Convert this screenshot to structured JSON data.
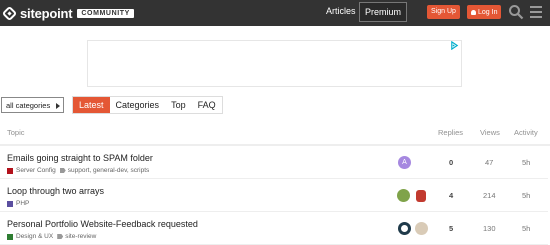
{
  "header": {
    "logo_text": "sitepoint",
    "logo_badge": "COMMUNITY",
    "nav_articles": "Articles",
    "nav_premium": "Premium",
    "signup_label": "Sign Up",
    "login_label": "Log In",
    "bg_color": "#333333",
    "accent_color": "#e45735"
  },
  "filters": {
    "category_dropdown": "all categories",
    "tabs": [
      {
        "label": "Latest",
        "active": true
      },
      {
        "label": "Categories",
        "active": false
      },
      {
        "label": "Top",
        "active": false
      },
      {
        "label": "FAQ",
        "active": false
      }
    ]
  },
  "table": {
    "columns": {
      "topic": "Topic",
      "replies": "Replies",
      "views": "Views",
      "activity": "Activity"
    },
    "rows": [
      {
        "title": "Emails going straight to SPAM folder",
        "category": "Server Config",
        "category_color": "#b3121c",
        "tags": "support, general-dev, scripts",
        "avatars": [
          {
            "letter": "A",
            "color": "#a688e0"
          }
        ],
        "replies": "0",
        "views": "47",
        "activity": "5h"
      },
      {
        "title": "Loop through two arrays",
        "category": "PHP",
        "category_color": "#5b4fa0",
        "tags": "",
        "avatars": [
          {
            "letter": "",
            "color": "#7fa34a"
          },
          {
            "letter": "",
            "color": "#c23a2f"
          }
        ],
        "replies": "4",
        "views": "214",
        "activity": "5h"
      },
      {
        "title": "Personal Portfolio Website-Feedback requested",
        "category": "Design & UX",
        "category_color": "#2e7d32",
        "tags": "site-review",
        "avatars": [
          {
            "letter": "",
            "color": "#1f3a4a"
          },
          {
            "letter": "",
            "color": "#d9cbb7"
          }
        ],
        "replies": "5",
        "views": "130",
        "activity": "5h"
      }
    ]
  }
}
